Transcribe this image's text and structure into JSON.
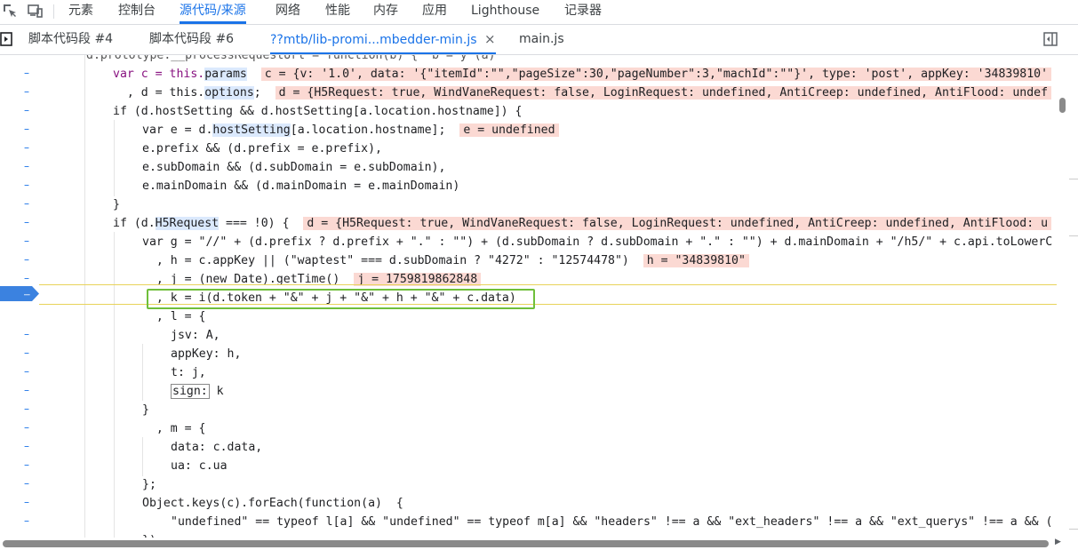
{
  "main_tabs": [
    "元素",
    "控制台",
    "源代码/来源",
    "网络",
    "性能",
    "内存",
    "应用",
    "Lighthouse",
    "记录器"
  ],
  "file_tabs": [
    "脚本代码段 #4",
    "脚本代码段 #6",
    "??mtb/lib-promi...mbedder-min.js",
    "main.js"
  ],
  "file_tab_close": "×",
  "code": {
    "l0": "d.prototype.__processRequestUrl = function(b) {  b = y (a)",
    "l1a": "var c = this.",
    "l1b": "params",
    "l1c": "c = {v: '1.0', data: '{\"itemId\":\"\",\"pageSize\":30,\"pageNumber\":3,\"machId\":\"\"}', type: 'post', appKey: '34839810'",
    "l2a": "  , d = this.",
    "l2b": "options",
    "l2c": "d = {H5Request: true, WindVaneRequest: false, LoginRequest: undefined, AntiCreep: undefined, AntiFlood: undef",
    "l3": "if (d.hostSetting && d.hostSetting[a.location.hostname]) {",
    "l4a": "var e = d.",
    "l4b": "hostSetting",
    "l4c": "[a.location.hostname];",
    "l4d": "e = undefined",
    "l5": "e.prefix && (d.prefix = e.prefix),",
    "l6": "e.subDomain && (d.subDomain = e.subDomain),",
    "l7": "e.mainDomain && (d.mainDomain = e.mainDomain)",
    "l8": "}",
    "l9a": "if (d.",
    "l9b": "H5Request",
    "l9c": " === !0) {",
    "l9d": "d = {H5Request: true, WindVaneRequest: false, LoginRequest: undefined, AntiCreep: undefined, AntiFlood: u",
    "l10": "var g = \"//\" + (d.prefix ? d.prefix + \".\" : \"\") + (d.subDomain ? d.subDomain + \".\" : \"\") + d.mainDomain + \"/h5/\" + c.api.toLowerC",
    "l11a": "  , h = c.appKey || (\"waptest\" === d.subDomain ? \"4272\" : \"12574478\")",
    "l11b": "h = \"34839810\"",
    "l12a": "  , j = (new Date).getTime()",
    "l12b": "j = 1759819862848",
    "l13": "  , k = i(d.token + \"&\" + j + \"&\" + h + \"&\" + c.data)",
    "l14": "  , l = {",
    "l15": "jsv: A,",
    "l16": "appKey: h,",
    "l17": "t: j,",
    "l18a": "sign:",
    "l18b": " k",
    "l19": "}",
    "l20": "  , m = {",
    "l21": "data: c.data,",
    "l22": "ua: c.ua",
    "l23": "};",
    "l24": "Object.keys(c).forEach(function(a)  {",
    "l25": "\"undefined\" == typeof l[a] && \"undefined\" == typeof m[a] && \"headers\" !== a && \"ext_headers\" !== a && \"ext_querys\" !== a && (",
    "l26": "})"
  },
  "gutter_marker": "–",
  "colors": {
    "accent": "#1a73e8",
    "inline_value_bg": "#fbd9d3",
    "highlight_box": "#6fbf3a"
  }
}
